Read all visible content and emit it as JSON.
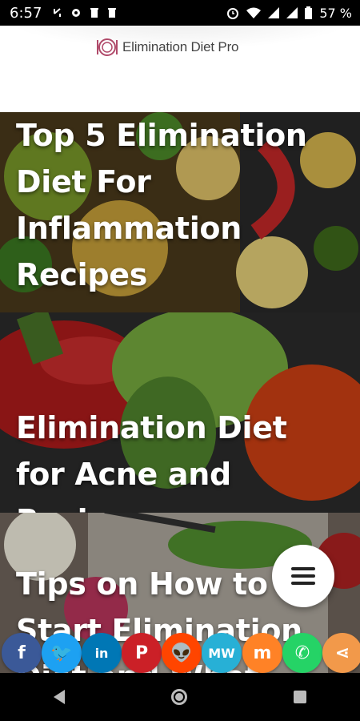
{
  "status_bar": {
    "time": "6:57",
    "battery": "57 %",
    "left_icons": [
      "missed-call-icon",
      "settings-gear-icon",
      "trash-icon",
      "trash-icon"
    ],
    "right_icons": [
      "alarm-icon",
      "wifi-icon",
      "signal-icon",
      "signal-icon",
      "battery-icon"
    ]
  },
  "header": {
    "app_name": "Elimination Diet Pro",
    "logo_icon": "plate-fork-knife-icon"
  },
  "articles": [
    {
      "title": "Top 5 Elimination Diet For Inflammation Recipes"
    },
    {
      "title": "Elimination Diet for Acne and Recipes"
    },
    {
      "title": "Tips on How to Start Elimination Diet and What"
    }
  ],
  "menu_fab_icon": "hamburger-menu-icon",
  "share_buttons": [
    {
      "name": "facebook",
      "glyph": "f",
      "color": "#3b5998"
    },
    {
      "name": "twitter",
      "glyph": "🐦",
      "color": "#1da1f2"
    },
    {
      "name": "linkedin",
      "glyph": "in",
      "color": "#0077b5"
    },
    {
      "name": "pinterest",
      "glyph": "P",
      "color": "#cb2027"
    },
    {
      "name": "reddit",
      "glyph": "👽",
      "color": "#ff4500"
    },
    {
      "name": "mewe",
      "glyph": "MW",
      "color": "#27b0d6"
    },
    {
      "name": "mix",
      "glyph": "m",
      "color": "#ff8226"
    },
    {
      "name": "whatsapp",
      "glyph": "✆",
      "color": "#25d366"
    },
    {
      "name": "share",
      "glyph": "⋖",
      "color": "#f2994a"
    }
  ],
  "nav_bar": [
    "back-icon",
    "home-icon",
    "recents-icon"
  ]
}
